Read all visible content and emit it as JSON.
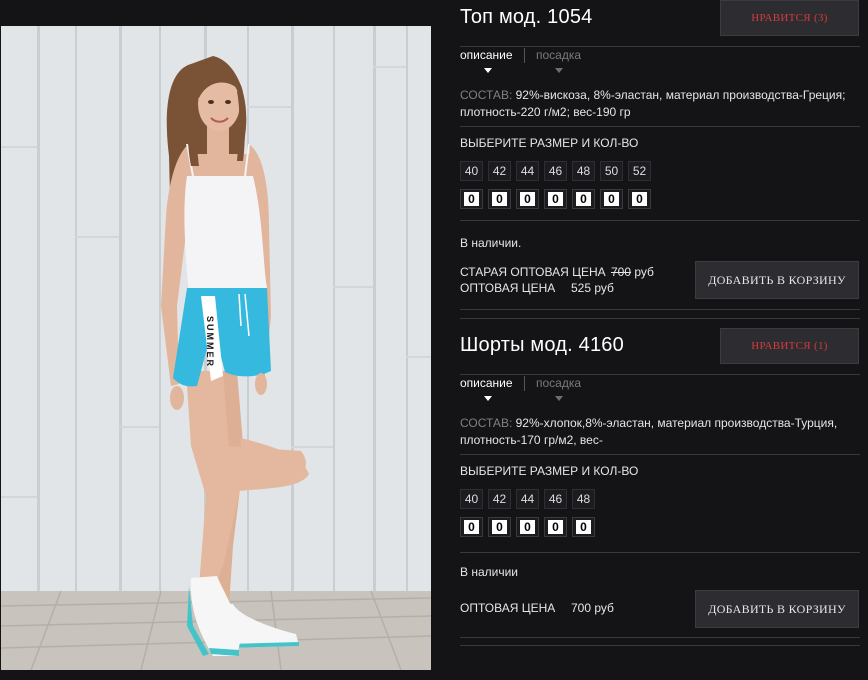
{
  "products": [
    {
      "title": "Топ мод. 1054",
      "like_label": "НРАВИТСЯ (3)",
      "tabs": [
        {
          "label": "описание",
          "active": true
        },
        {
          "label": "посадка",
          "active": false
        }
      ],
      "composition_label": "СОСТАВ:",
      "composition_text": "92%-вискоза, 8%-эластан, материал производства-Греция; плотность-220 г/м2; вес-190 гр",
      "size_title": "ВЫБЕРИТЕ РАЗМЕР И КОЛ-ВО",
      "sizes": [
        "40",
        "42",
        "44",
        "46",
        "48",
        "50",
        "52"
      ],
      "quantities": [
        "0",
        "0",
        "0",
        "0",
        "0",
        "0",
        "0"
      ],
      "stock": "В наличии.",
      "old_price_label": "СТАРАЯ ОПТОВАЯ ЦЕНА",
      "old_price_value": "700",
      "old_price_currency": "руб",
      "price_label": "ОПТОВАЯ ЦЕНА",
      "price_value": "525 руб",
      "cart_label": "ДОБАВИТЬ В КОРЗИНУ"
    },
    {
      "title": "Шорты мод. 4160",
      "like_label": "НРАВИТСЯ (1)",
      "tabs": [
        {
          "label": "описание",
          "active": true
        },
        {
          "label": "посадка",
          "active": false
        }
      ],
      "composition_label": "СОСТАВ:",
      "composition_text": "92%-хлопок,8%-эластан, материал производства-Турция, плотность-170 гр/м2, вес-",
      "size_title": "ВЫБЕРИТЕ РАЗМЕР И КОЛ-ВО",
      "sizes": [
        "40",
        "42",
        "44",
        "46",
        "48"
      ],
      "quantities": [
        "0",
        "0",
        "0",
        "0",
        "0"
      ],
      "stock": "В наличии",
      "price_label": "ОПТОВАЯ ЦЕНА",
      "price_value": "700 руб",
      "cart_label": "ДОБАВИТЬ В КОРЗИНУ"
    }
  ],
  "photo": {
    "shorts_print": "SUMMER",
    "colors": {
      "wall": "#e3e6e8",
      "floor": "#c9c4bf",
      "shorts": "#35b9de",
      "top": "#f4f4f6",
      "skin": "#e2b59d",
      "hair": "#7a5236"
    }
  }
}
